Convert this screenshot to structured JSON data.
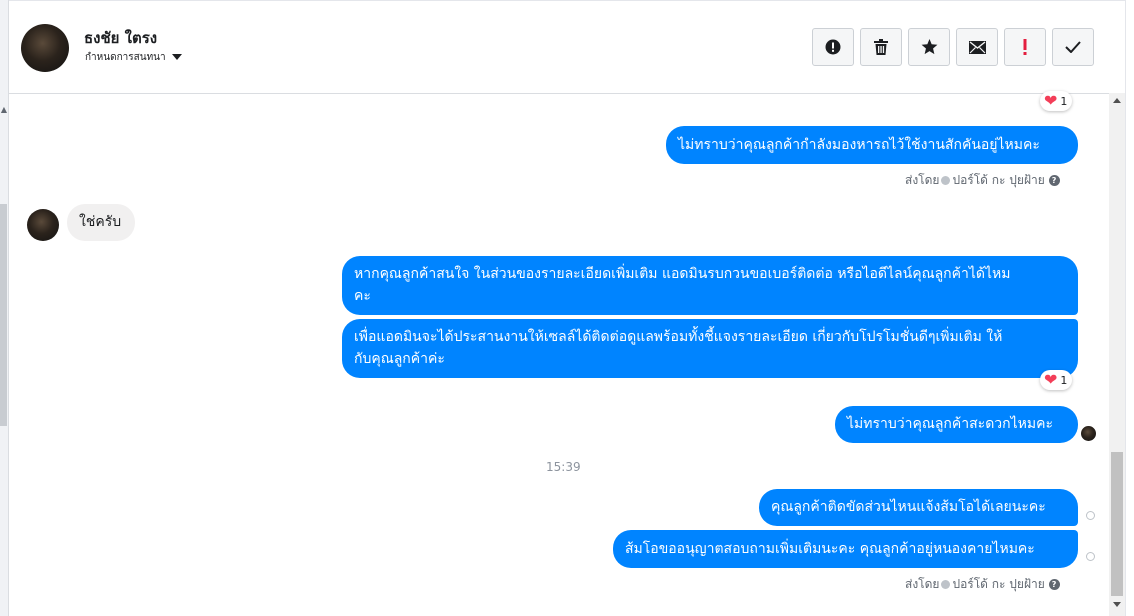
{
  "header": {
    "contact_name": "ธงชัย ใตรง",
    "assign_label": "กำหนดการสนทนา",
    "toolbar": [
      {
        "name": "alert-icon",
        "glyph": "!"
      },
      {
        "name": "trash-icon",
        "glyph": "🗑"
      },
      {
        "name": "star-icon",
        "glyph": "★"
      },
      {
        "name": "mail-icon",
        "glyph": "✉"
      },
      {
        "name": "spam-icon",
        "glyph": "!"
      },
      {
        "name": "checkmark-icon",
        "glyph": "✓"
      }
    ]
  },
  "messages": {
    "m1": "ไม่ทราบว่าคุณลูกค้ากำลังมองหารถไว้ใช้งานสักคันอยู่ไหมคะ",
    "m1_reaction_count": "1",
    "sent_by_label": "ส่งโดย",
    "sender_name": "ปอร์โด้ กะ ปุยฝ้าย",
    "m2_incoming": "ใช่ครับ",
    "m3_line1": "หากคุณลูกค้าสนใจ ในส่วนของรายละเอียดเพิ่มเติม แอดมินรบกวนขอเบอร์ติดต่อ หรือไอดีไลน์คุณลูกค้าได้ไหม",
    "m3_line2": "คะ",
    "m4_line1": "เพื่อแอดมินจะได้ประสานงานให้เซลล์ได้ติดต่อดูแลพร้อมทั้งชี้แจงรายละเอียด เกี่ยวกับโปรโมชั่นดีๆเพิ่มเติม ให้",
    "m4_line2": "กับคุณลูกค้าค่ะ",
    "m4_reaction_count": "1",
    "m5": "ไม่ทราบว่าคุณลูกค้าสะดวกไหมคะ",
    "time_separator": "15:39",
    "m6": "คุณลูกค้าติดขัดส่วนไหนแจ้งส้มโอได้เลยนะคะ",
    "m7": "ส้มโอขออนุญาตสอบถามเพิ่มเติมนะคะ คุณลูกค้าอยู่หนองคายไหมคะ",
    "sent_by_label_2": "ส่งโดย",
    "sender_name_2": "ปอร์โด้ กะ ปุยฝ้าย"
  },
  "colors": {
    "outgoing_bubble": "#0084ff",
    "incoming_bubble": "#f1f0f0",
    "heart": "#f33e58",
    "spam_red": "#e41e3f"
  }
}
